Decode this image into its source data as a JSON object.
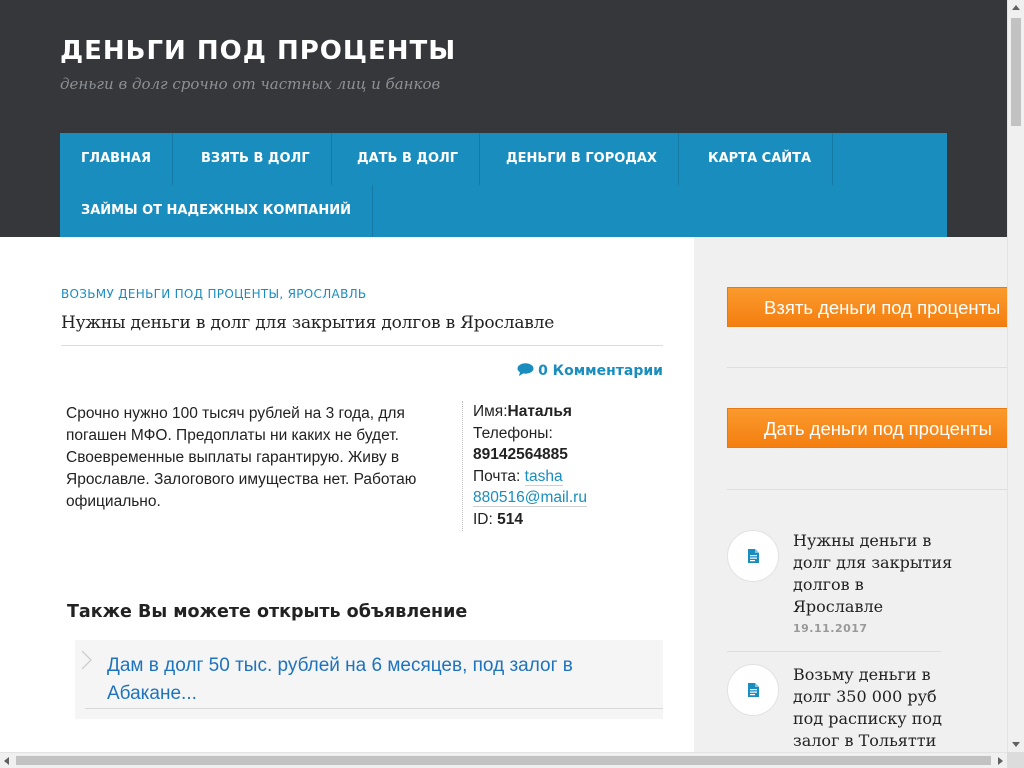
{
  "site": {
    "title": "ДЕНЬГИ ПОД ПРОЦЕНТЫ",
    "description": "деньги в долг срочно от частных лиц и банков"
  },
  "nav": {
    "items": [
      {
        "label": "Главная"
      },
      {
        "label": "Взять в долг"
      },
      {
        "label": "Дать в долг"
      },
      {
        "label": "Деньги в городах"
      },
      {
        "label": "Карта сайта"
      },
      {
        "label": "Займы от надежных компаний"
      }
    ]
  },
  "post": {
    "category": "ВОЗЬМУ ДЕНЬГИ ПОД ПРОЦЕНТЫ, ЯРОСЛАВЛЬ",
    "title": "Нужны деньги в долг для закрытия долгов в Ярославле",
    "comments": "0 Комментарии",
    "text": "Срочно нужно 100 тысяч рублей на 3 года, для погашен МФО. Предоплаты ни каких не будет. Своевременные выплаты гарантирую. Живу в Ярославле. Залогового имущества нет. Работаю официально.",
    "info": {
      "name_label": "Имя:",
      "name_value": "Наталья",
      "phones_label": "Телефоны:",
      "phone_value": "89142564885",
      "mail_label": "Почта: ",
      "mail_value": "tasha 880516@mail.ru",
      "id_label": "ID: ",
      "id_value": "514"
    },
    "also_title": "Также Вы можете открыть объявление",
    "related_link": "Дам в долг 50 тыс. рублей на 6 месяцев, под залог в Абакане..."
  },
  "sidebar": {
    "button_take": "Взять деньги под проценты",
    "button_give": "Дать деньги под проценты",
    "recent": [
      {
        "title": "Нужны деньги в долг для закрытия долгов в Ярославле",
        "date": "19.11.2017"
      },
      {
        "title": "Возьму деньги в долг 350 000 руб под расписку под залог в Тольятти",
        "date": ""
      }
    ]
  },
  "colors": {
    "header_bg": "#35373b",
    "nav_bg": "#1a8dbf",
    "accent": "#1a8dbf",
    "link": "#1e73be",
    "button_orange": "#f7891e",
    "sidebar_bg": "#f0f0f0"
  },
  "icons": {
    "comments": "comment-bubble-icon",
    "recent_post": "document-icon",
    "related": "chevron-right-icon"
  }
}
